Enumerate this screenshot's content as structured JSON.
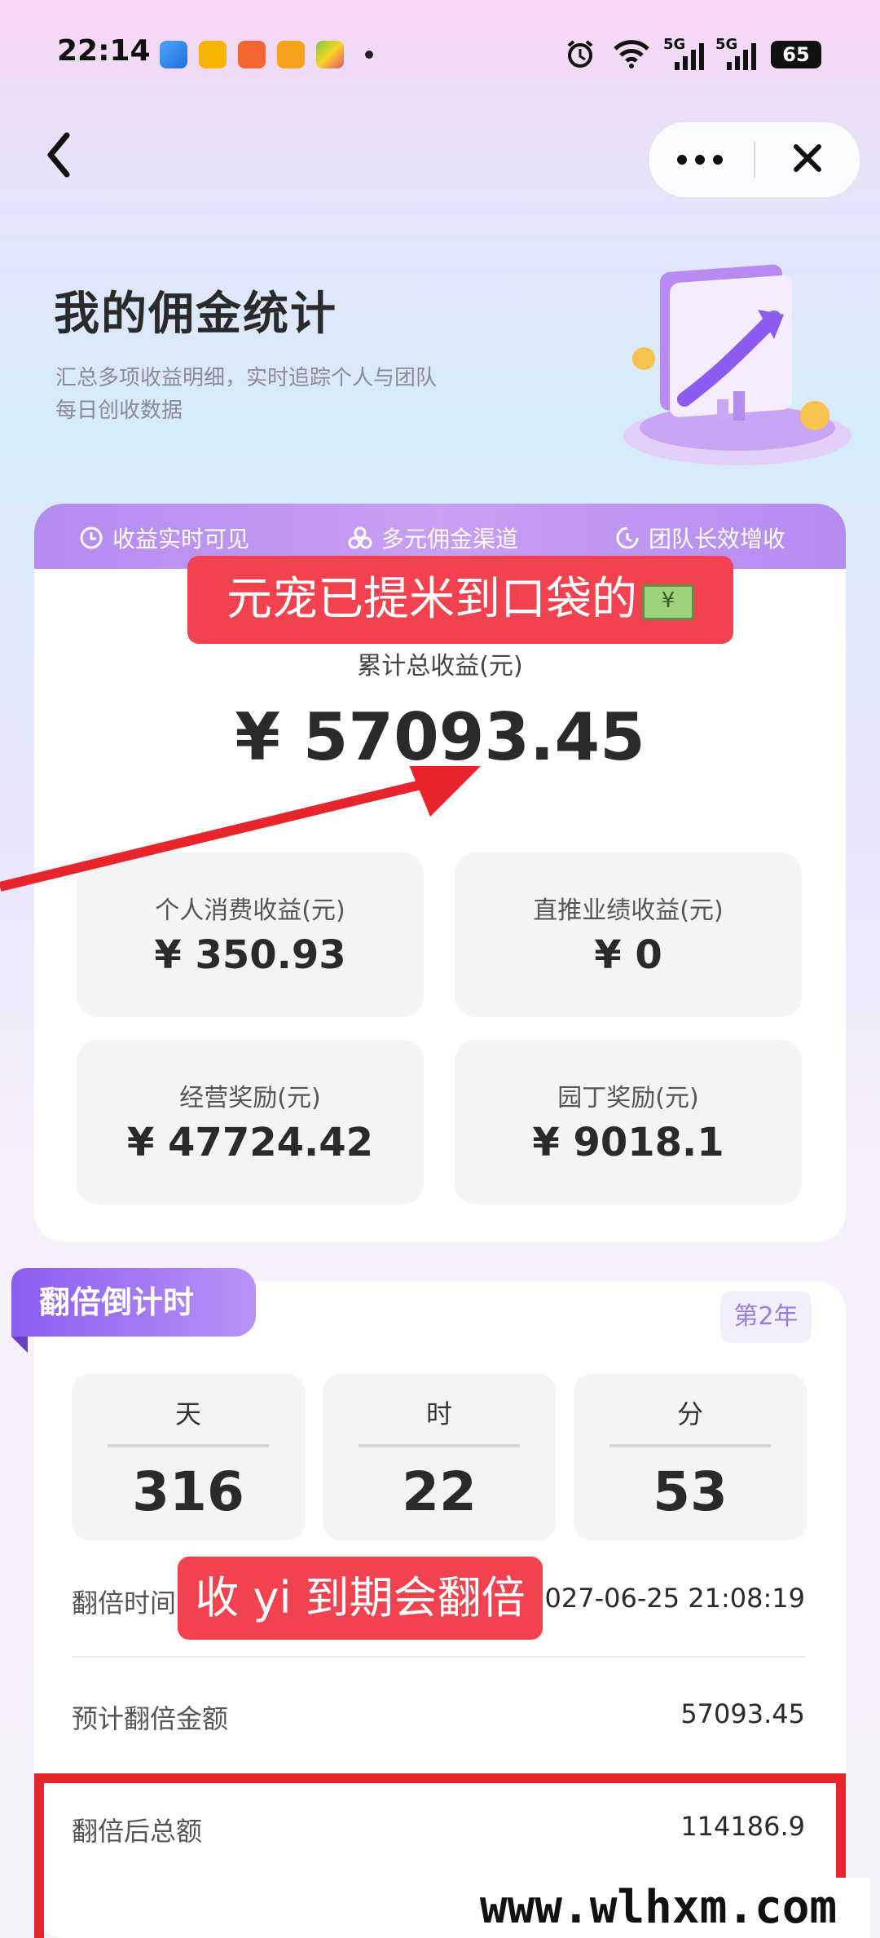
{
  "status_bar": {
    "time": "22:14",
    "battery": "65",
    "signal_1": "5G",
    "signal_2": "5G"
  },
  "page": {
    "title": "我的佣金统计",
    "subtitle_line1": "汇总多项收益明细，实时追踪个人与团队",
    "subtitle_line2": "每日创收数据"
  },
  "features": [
    "收益实时可见",
    "多元佣金渠道",
    "团队长效增收"
  ],
  "overlay": {
    "banner_top": "元宠已提米到口袋的",
    "banner_bottom": "收 yi 到期会翻倍",
    "watermark": "www.wlhxm.com"
  },
  "earnings": {
    "total_label": "累计总收益(元)",
    "total_value": "¥ 57093.45",
    "tiles": [
      {
        "label": "个人消费收益(元)",
        "value": "¥ 350.93"
      },
      {
        "label": "直推业绩收益(元)",
        "value": "¥ 0"
      },
      {
        "label": "经营奖励(元)",
        "value": "¥ 47724.42"
      },
      {
        "label": "园丁奖励(元)",
        "value": "¥ 9018.1"
      }
    ]
  },
  "countdown": {
    "tag": "翻倍倒计时",
    "year_badge": "第2年",
    "units": [
      {
        "unit": "天",
        "value": "316"
      },
      {
        "unit": "时",
        "value": "22"
      },
      {
        "unit": "分",
        "value": "53"
      }
    ],
    "rows": [
      {
        "label": "翻倍时间",
        "value": "2027-06-25 21:08:19"
      },
      {
        "label": "预计翻倍金额",
        "value": "57093.45"
      },
      {
        "label": "翻倍后总额",
        "value": "114186.9"
      }
    ]
  },
  "colors": {
    "accent": "#b48cf0",
    "banner": "#f2424f",
    "highlight": "#e8242d"
  }
}
